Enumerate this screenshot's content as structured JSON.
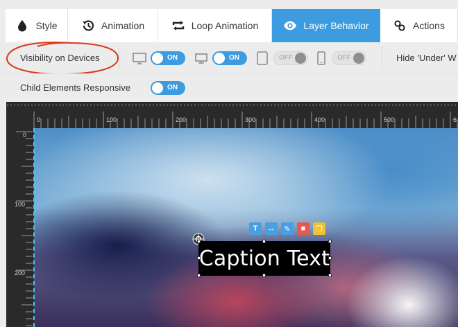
{
  "tabs": [
    {
      "label": "Style",
      "icon": "droplet-icon",
      "active": false
    },
    {
      "label": "Animation",
      "icon": "history-icon",
      "active": false
    },
    {
      "label": "Loop Animation",
      "icon": "loop-icon",
      "active": false
    },
    {
      "label": "Layer Behavior",
      "icon": "eye-icon",
      "active": true
    },
    {
      "label": "Actions",
      "icon": "link-icon",
      "active": false
    }
  ],
  "visibility": {
    "label": "Visibility on Devices",
    "devices": [
      {
        "device": "desktop",
        "icon": "desktop-icon",
        "state": "ON"
      },
      {
        "device": "notebook",
        "icon": "notebook-icon",
        "state": "ON"
      },
      {
        "device": "tablet",
        "icon": "tablet-icon",
        "state": "OFF"
      },
      {
        "device": "mobile",
        "icon": "mobile-icon",
        "state": "OFF"
      }
    ],
    "hide_label": "Hide 'Under' W"
  },
  "child_responsive": {
    "label": "Child Elements Responsive",
    "state": "ON"
  },
  "ruler": {
    "h_labels": [
      "0",
      "100",
      "200",
      "300",
      "400",
      "500",
      "6"
    ],
    "v_labels": [
      "0",
      "100",
      "200"
    ]
  },
  "layer": {
    "caption_text": "Caption Text",
    "tools": [
      "T",
      "↔",
      "✎",
      "■",
      "❐"
    ]
  },
  "colors": {
    "accent": "#3d9ce0",
    "guide": "#49c6f0",
    "annotation": "#d63a1a"
  }
}
